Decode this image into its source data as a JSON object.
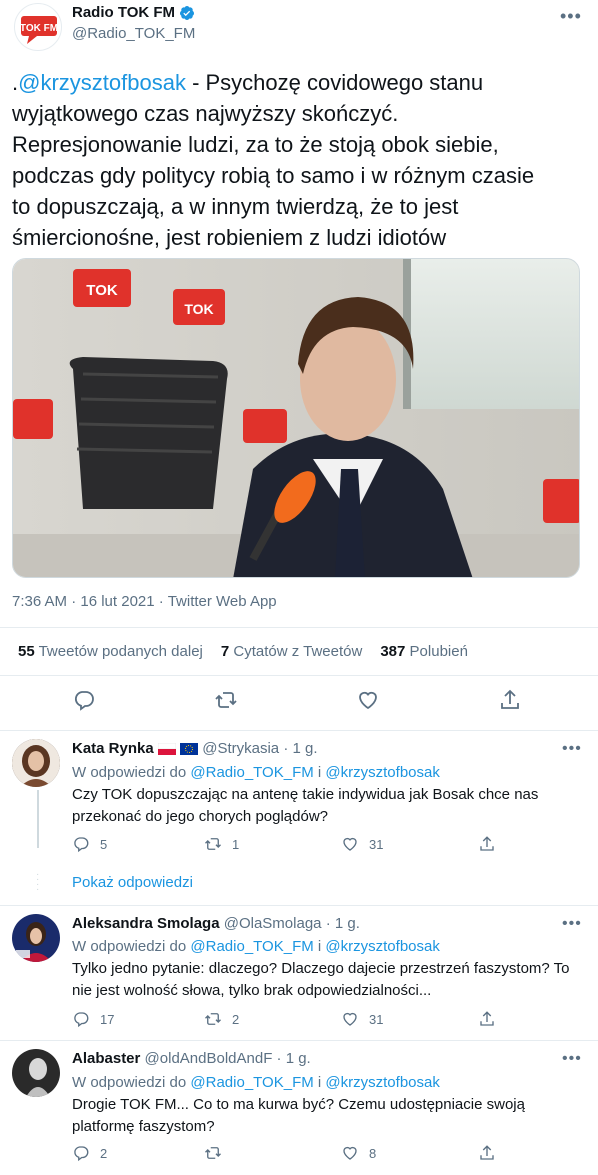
{
  "tweet": {
    "author_name": "Radio TOK FM",
    "author_handle": "@Radio_TOK_FM",
    "avatar_logo_text": "TOK FM",
    "text_mention": "@krzysztofbosak",
    "text_prefix": ".",
    "text_body_line1": " - Psychozę covidowego stanu",
    "text_body_rest_lines": [
      "wyjątkowego czas najwyższy skończyć.",
      "Represjonowanie ludzi, za to że stoją obok siebie,",
      "podczas gdy politycy robią to samo i w różnym czasie",
      "to dopuszczają, a w innym twierdzą, że to jest",
      "śmiercionośne, jest robieniem z ludzi idiotów"
    ],
    "media_logo_text": "TOK FM",
    "timestamp": "7:36 AM · 16 lut 2021",
    "source": "Twitter Web App",
    "stats": {
      "retweets_count": "55",
      "retweets_label": "Tweetów podanych dalej",
      "quotes_count": "7",
      "quotes_label": "Cytatów z Tweetów",
      "likes_count": "387",
      "likes_label": "Polubień"
    }
  },
  "replies": [
    {
      "name": "Kata Rynka",
      "handle": "@Strykasia",
      "time": "· 1 g.",
      "context_prefix": "W odpowiedzi do",
      "context_user1": "@Radio_TOK_FM",
      "context_and": "i",
      "context_user2": "@krzysztofbosak",
      "text_lines": [
        "Czy TOK dopuszczając na antenę takie indywidua jak Bosak chce nas",
        "przekonać do jego chorych poglądów?"
      ],
      "replies_count": "5",
      "retweets_count": "1",
      "likes_count": "31"
    },
    {
      "name": "Aleksandra Smolaga",
      "handle": "@OlaSmolaga",
      "time": "· 1 g.",
      "context_prefix": "W odpowiedzi do",
      "context_user1": "@Radio_TOK_FM",
      "context_and": "i",
      "context_user2": "@krzysztofbosak",
      "text_lines": [
        "Tylko jedno pytanie: dlaczego? Dlaczego dajecie przestrzeń faszystom? To",
        "nie jest wolność słowa, tylko brak odpowiedzialności..."
      ],
      "replies_count": "17",
      "retweets_count": "2",
      "likes_count": "31"
    },
    {
      "name": "Alabaster",
      "handle": "@oldAndBoldAndF",
      "time": "· 1 g.",
      "context_prefix": "W odpowiedzi do",
      "context_user1": "@Radio_TOK_FM",
      "context_and": "i",
      "context_user2": "@krzysztofbosak",
      "text_lines": [
        "Drogie TOK FM... Co to ma kurwa być? Czemu udostępniacie swoją",
        "platformę faszystom?"
      ],
      "replies_count": "2",
      "retweets_count": "",
      "likes_count": "8"
    }
  ],
  "show_replies_label": "Pokaż odpowiedzi",
  "colors": {
    "accent": "#1b95e0",
    "brand_red": "#e0322b",
    "muted": "#5b7083",
    "border": "#e6ecf0"
  },
  "icons": [
    "verified-badge-icon",
    "more-icon",
    "reply-icon",
    "retweet-icon",
    "like-icon",
    "share-icon"
  ]
}
